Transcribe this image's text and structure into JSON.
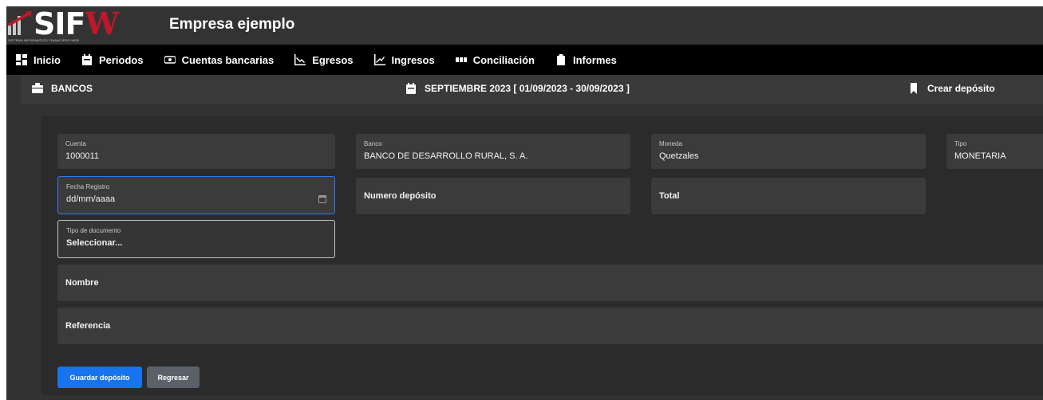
{
  "header": {
    "logo_text": "SIFW",
    "logo_tagline": "SISTEMA INFORMATICO FINANCIERO WEB",
    "company": "Empresa ejemplo"
  },
  "nav": {
    "items": [
      {
        "label": "Inicio",
        "icon": "grid-icon"
      },
      {
        "label": "Periodos",
        "icon": "calendar-icon"
      },
      {
        "label": "Cuentas bancarias",
        "icon": "money-icon"
      },
      {
        "label": "Egresos",
        "icon": "chart-down-icon"
      },
      {
        "label": "Ingresos",
        "icon": "chart-up-icon"
      },
      {
        "label": "Conciliación",
        "icon": "columns-icon"
      },
      {
        "label": "Informes",
        "icon": "clipboard-icon"
      }
    ]
  },
  "subbar": {
    "section": "BANCOS",
    "period": "SEPTIEMBRE 2023 [ 01/09/2023 - 30/09/2023 ]",
    "action": "Crear depósito"
  },
  "form": {
    "cuenta": {
      "label": "Cuenta",
      "value": "1000011"
    },
    "banco": {
      "label": "Banco",
      "value": "BANCO DE DESARROLLO RURAL, S. A."
    },
    "moneda": {
      "label": "Moneda",
      "value": "Quetzales"
    },
    "tipo": {
      "label": "Tipo",
      "value": "MONETARIA"
    },
    "fecha": {
      "label": "Fecha Registro",
      "value": "dd/mm/aaaa"
    },
    "numero_deposito": {
      "placeholder": "Numero depósito"
    },
    "total": {
      "placeholder": "Total"
    },
    "tipo_documento": {
      "label": "Tipo de documento",
      "value": "Seleccionar..."
    },
    "nombre": {
      "placeholder": "Nombre"
    },
    "referencia": {
      "placeholder": "Referencia"
    }
  },
  "buttons": {
    "save": "Guardar depósito",
    "back": "Regresar"
  },
  "colors": {
    "accent": "#1873ee",
    "brand_red": "#c0182a",
    "focus_border": "#2f7ef0"
  }
}
